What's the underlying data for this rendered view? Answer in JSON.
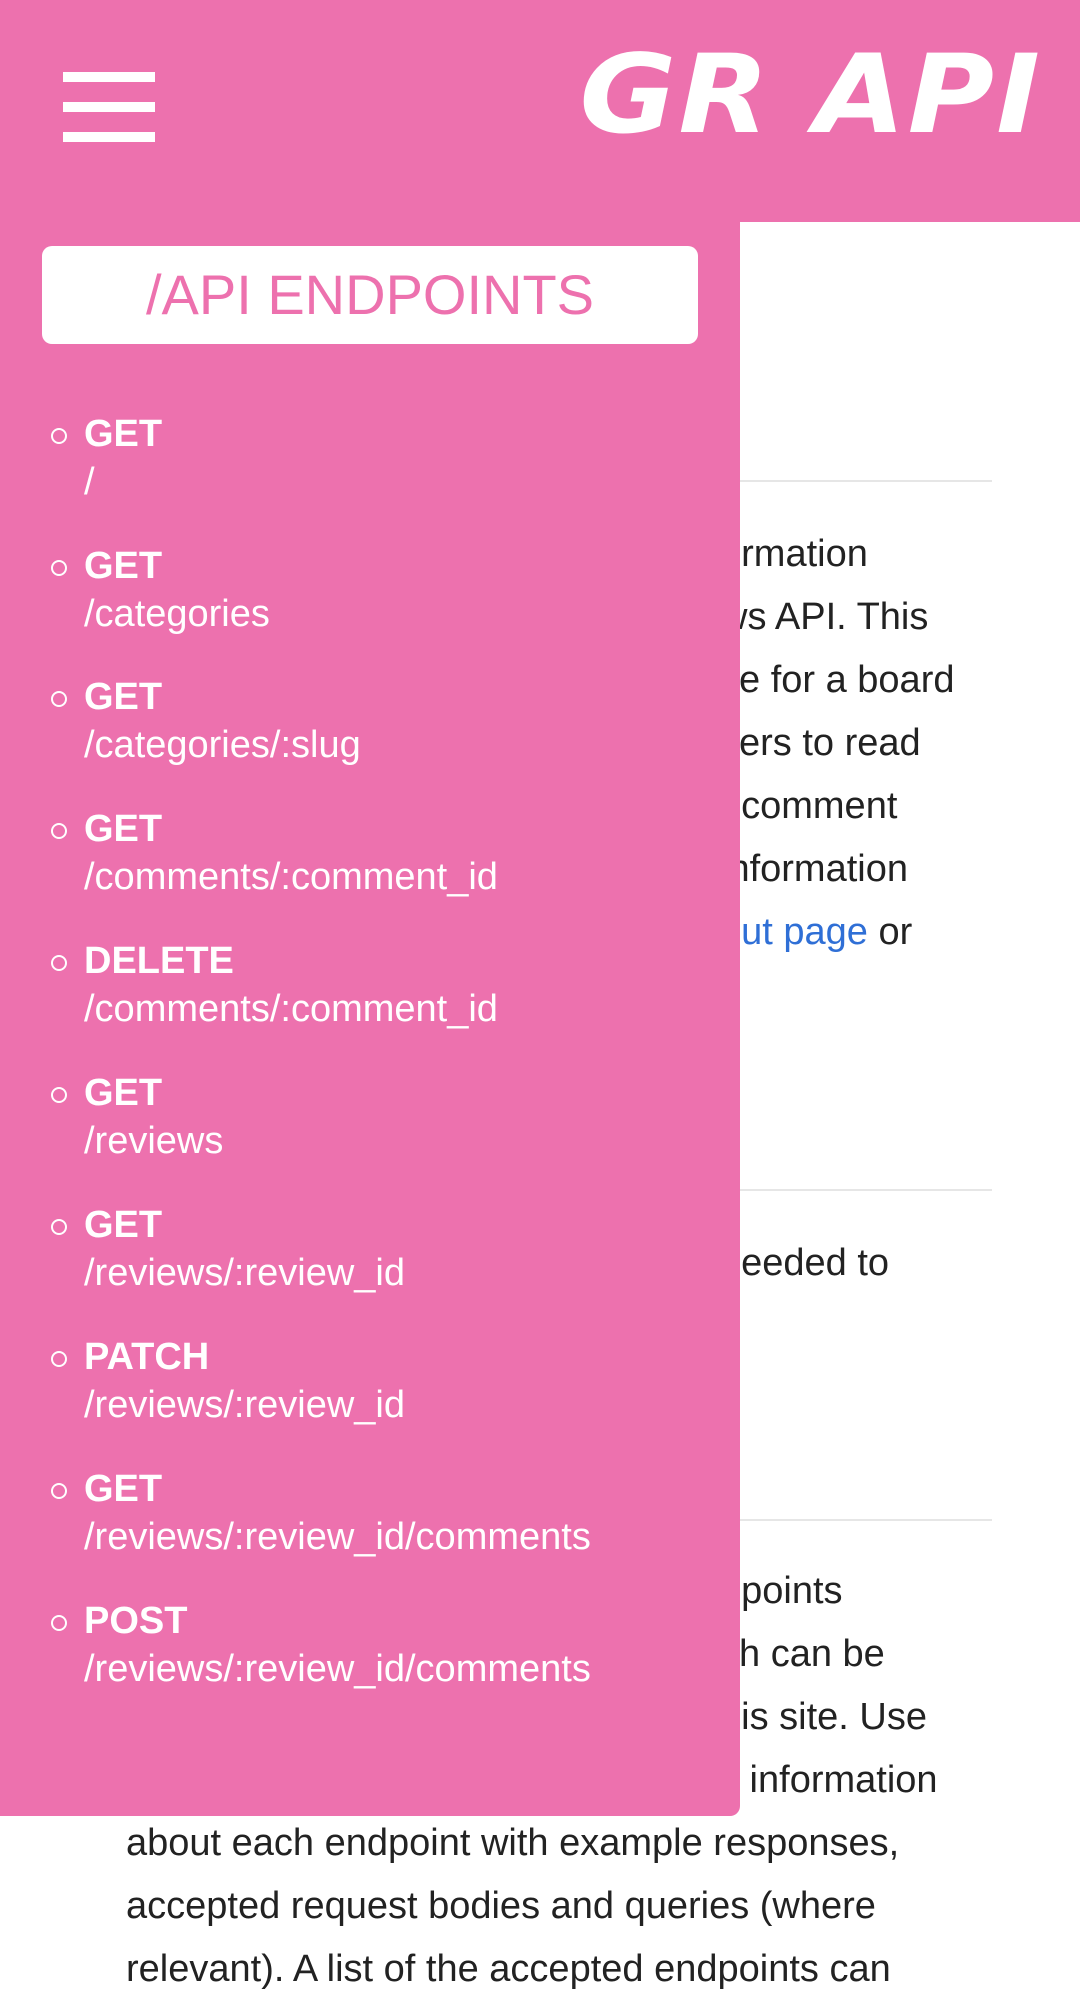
{
  "header": {
    "logo": "GR API",
    "background": "#ed71ae"
  },
  "drawer": {
    "title": "/API ENDPOINTS",
    "endpoints": [
      {
        "method": "GET",
        "path": "/"
      },
      {
        "method": "GET",
        "path": "/categories"
      },
      {
        "method": "GET",
        "path": "/categories/:slug"
      },
      {
        "method": "GET",
        "path": "/comments/:comment_id"
      },
      {
        "method": "DELETE",
        "path": "/comments/:comment_id"
      },
      {
        "method": "GET",
        "path": "/reviews"
      },
      {
        "method": "GET",
        "path": "/reviews/:review_id"
      },
      {
        "method": "PATCH",
        "path": "/reviews/:review_id"
      },
      {
        "method": "GET",
        "path": "/reviews/:review_id/comments"
      },
      {
        "method": "POST",
        "path": "/reviews/:review_id/comments"
      }
    ]
  },
  "background_content": {
    "para1": {
      "line1": "ormation",
      "line2": "ws API. This",
      "line3": "se for a board",
      "line4": "sers to read",
      "line5": ", comment",
      "line6": "information",
      "link": "out page",
      "line7_after": " or"
    },
    "para2": {
      "line1": "needed to"
    },
    "para3": {
      "line1": "dpoints",
      "line2": "ch can be",
      "line3": "his site. Use",
      "line4": "s information",
      "line5": "about each endpoint with example responses,",
      "line6": "accepted request bodies and queries (where",
      "line7": "relevant). A list of the accepted endpoints can"
    }
  }
}
